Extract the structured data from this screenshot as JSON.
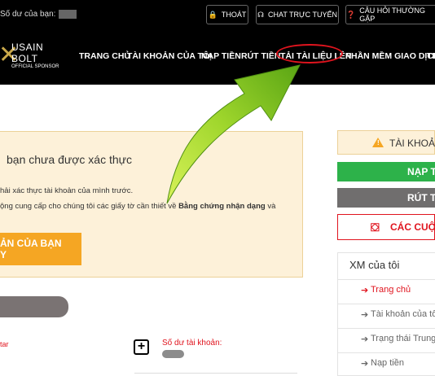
{
  "header": {
    "balance_label": "Số dư của bạn:",
    "logout_label": "THOÁT",
    "chat_label": "CHAT TRỰC TUYẾN",
    "faq_label": "CÂU HỎI THƯỜNG GẶP"
  },
  "logo": {
    "line1": "USAIN",
    "line2": "BOLT",
    "line3": "OFFICIAL SPONSOR"
  },
  "nav": {
    "items": [
      "TRANG CHỦ",
      "TÀI KHOẢN CỦA TÔI",
      "NẠP TIỀN",
      "RÚT TIỀN",
      "TẢI TÀI LIỆU LÊN",
      "PHẦN MỀM GIAO DỊCH",
      "TI"
    ]
  },
  "alert": {
    "title": "bạn chưa được xác thực",
    "line1": "hải xác thực tài khoản của mình trước.",
    "line2_prefix": "ộng cung cấp cho chúng tôi các giấy tờ cần thiết về ",
    "line2_bold": "Bằng chứng nhận dạng",
    "line2_suffix": " và",
    "button_line1": "ẢN CỦA BẠN",
    "button_line2": "Y"
  },
  "lower": {
    "red_text": "tar",
    "balance_label": "Số dư tài khoản:"
  },
  "sidebar": {
    "account_warning": "TÀI KHOẢN",
    "deposit": "NẠP T",
    "withdraw": "RÚT T",
    "competitions": "CÁC CUỘC",
    "menu_title": "XM của tôi",
    "menu_items": [
      "Trang chủ",
      "Tài khoản của tô",
      "Trạng thái Trung",
      "Nạp tiền"
    ]
  },
  "colors": {
    "header_bg": "#000000",
    "highlight_circle": "#e0141e",
    "arrow": "#8bd12a",
    "deposit_green": "#2db24a",
    "withdraw_grey": "#706e6e",
    "alert_bg": "#fdf1d9",
    "verify_orange": "#f5a623"
  }
}
